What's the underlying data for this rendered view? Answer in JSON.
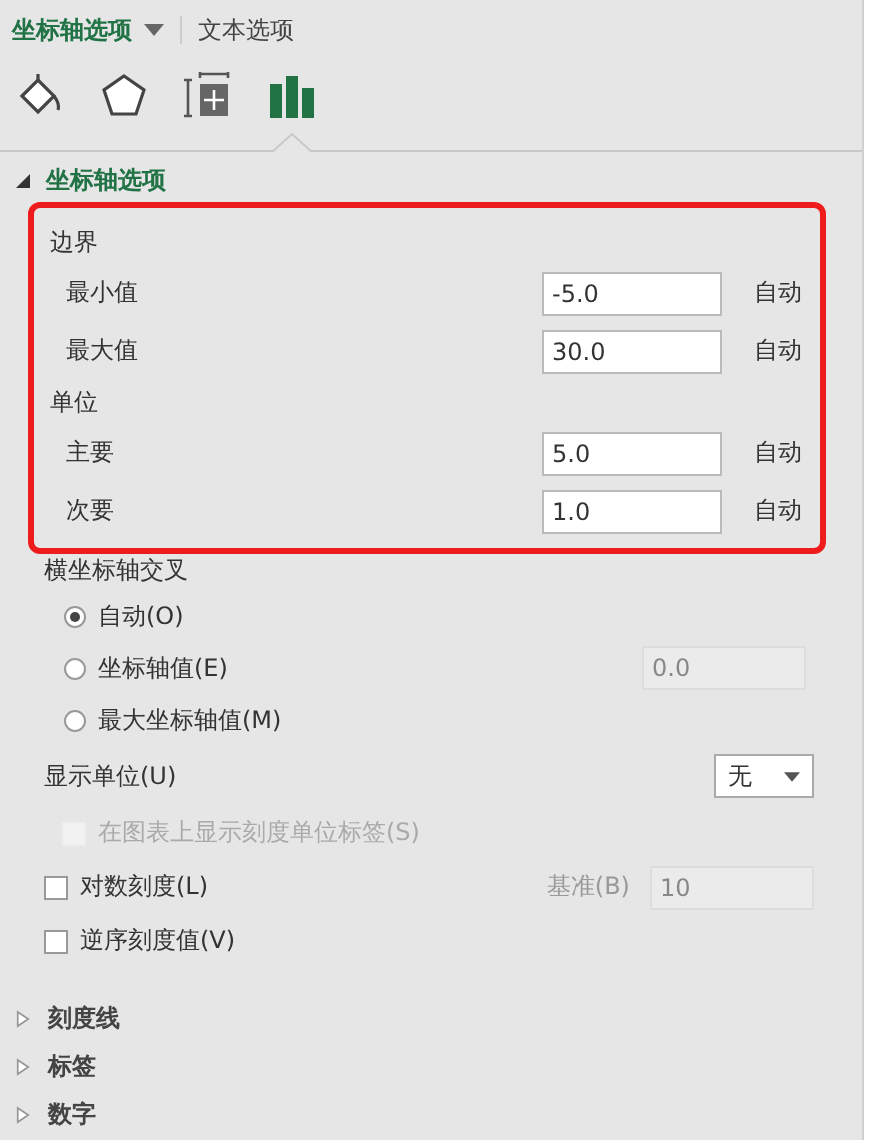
{
  "tabs": [
    {
      "label": "坐标轴选项",
      "selected": true,
      "has_menu": true
    },
    {
      "label": "文本选项",
      "selected": false,
      "has_menu": false
    }
  ],
  "icon_tabs": [
    {
      "kind": "fill",
      "selected": false
    },
    {
      "kind": "shape",
      "selected": false
    },
    {
      "kind": "size",
      "selected": false
    },
    {
      "kind": "chart",
      "selected": true
    }
  ],
  "section": {
    "title": "坐标轴选项",
    "expanded": true,
    "highlighted": true,
    "groups": [
      {
        "title": "边界",
        "rows": [
          {
            "label": "最小值",
            "value": "-5.0",
            "action": "自动"
          },
          {
            "label": "最大值",
            "value": "30.0",
            "action": "自动"
          }
        ]
      },
      {
        "title": "单位",
        "rows": [
          {
            "label": "主要",
            "value": "5.0",
            "action": "自动"
          },
          {
            "label": "次要",
            "value": "1.0",
            "action": "自动"
          }
        ]
      }
    ]
  },
  "crossing": {
    "title": "横坐标轴交叉",
    "options": [
      {
        "label": "自动(O)",
        "selected": true
      },
      {
        "label": "坐标轴值(E)",
        "selected": false,
        "value": "0.0"
      },
      {
        "label": "最大坐标轴值(M)",
        "selected": false
      }
    ]
  },
  "display_unit": {
    "label": "显示单位(U)",
    "value": "无"
  },
  "checks": [
    {
      "kind": "plain",
      "label": "在图表上显示刻度单位标签(S)",
      "checked": false,
      "disabled": true
    },
    {
      "kind": "base",
      "label": "对数刻度(L)",
      "checked": false,
      "disabled": false,
      "base_label": "基准(B)",
      "base_value": "10"
    },
    {
      "kind": "plain",
      "label": "逆序刻度值(V)",
      "checked": false,
      "disabled": false
    }
  ],
  "collapsed": [
    {
      "title": "刻度线",
      "expanded": false
    },
    {
      "title": "标签",
      "expanded": false
    },
    {
      "title": "数字",
      "expanded": false
    }
  ]
}
